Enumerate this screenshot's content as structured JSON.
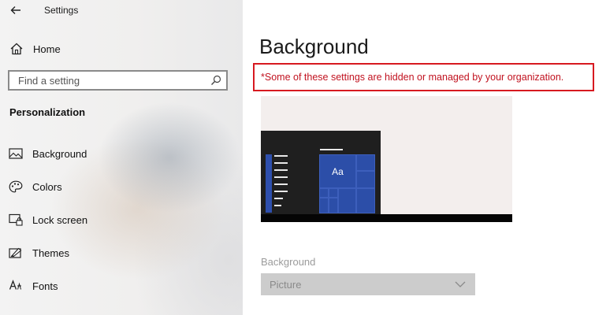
{
  "window": {
    "title": "Settings",
    "back_icon": "back-arrow-icon"
  },
  "sidebar": {
    "home_label": "Home",
    "search": {
      "placeholder": "Find a setting",
      "value": ""
    },
    "section_title": "Personalization",
    "items": [
      {
        "label": "Background",
        "icon": "picture-icon"
      },
      {
        "label": "Colors",
        "icon": "palette-icon"
      },
      {
        "label": "Lock screen",
        "icon": "lock-screen-icon"
      },
      {
        "label": "Themes",
        "icon": "themes-icon"
      },
      {
        "label": "Fonts",
        "icon": "fonts-icon"
      }
    ]
  },
  "main": {
    "title": "Background",
    "notice": "*Some of these settings are hidden or managed by your organization.",
    "preview": {
      "tile_text": "Aa"
    },
    "background_field": {
      "label": "Background",
      "value": "Picture",
      "disabled": true
    }
  },
  "colors": {
    "notice_red": "#d71920",
    "accent_blue": "#2c4ea8",
    "disabled_gray": "#cccccc"
  }
}
